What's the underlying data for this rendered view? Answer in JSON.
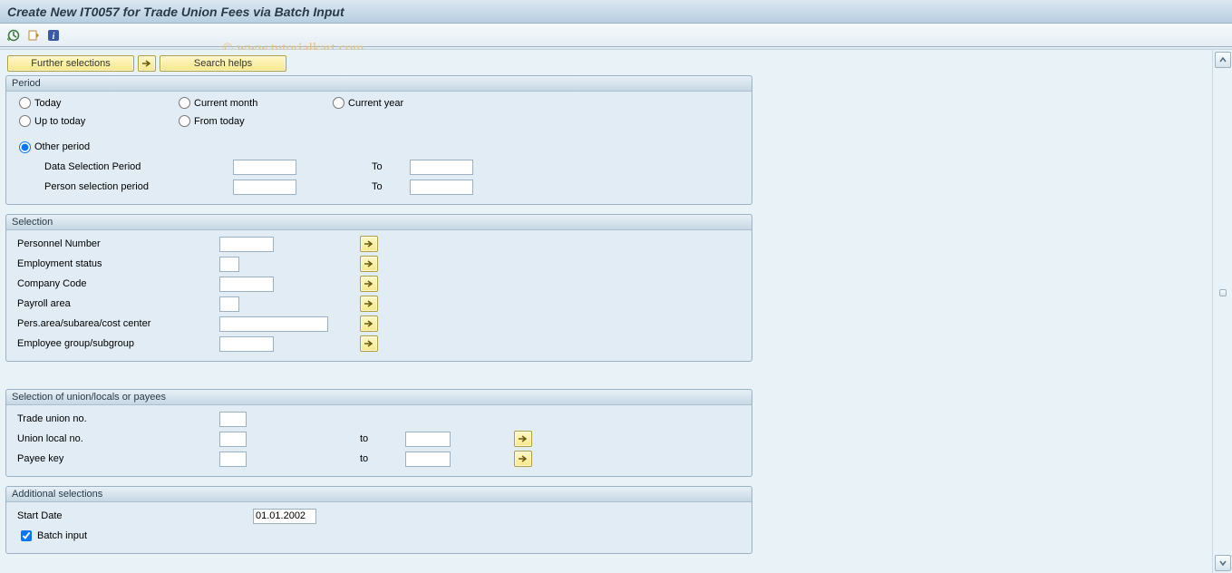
{
  "header": {
    "title": "Create New IT0057 for Trade Union Fees via Batch Input"
  },
  "watermark": "© www.tutorialkart.com",
  "toolbar": {
    "execute_icon": "execute-icon",
    "variant_icon": "variant-icon",
    "info_icon": "info-icon"
  },
  "btnrow": {
    "further_selections": "Further selections",
    "search_helps": "Search helps"
  },
  "period": {
    "title": "Period",
    "radios": {
      "today": "Today",
      "current_month": "Current month",
      "current_year": "Current year",
      "up_to_today": "Up to today",
      "from_today": "From today",
      "other_period": "Other period"
    },
    "data_sel_label": "Data Selection Period",
    "person_sel_label": "Person selection period",
    "to": "To",
    "data_from": "",
    "data_to": "",
    "person_from": "",
    "person_to": ""
  },
  "selection": {
    "title": "Selection",
    "rows": [
      {
        "label": "Personnel Number",
        "value": "",
        "size": "sm"
      },
      {
        "label": "Employment status",
        "value": "",
        "size": "xs"
      },
      {
        "label": "Company Code",
        "value": "",
        "size": "sm"
      },
      {
        "label": "Payroll area",
        "value": "",
        "size": "xs"
      },
      {
        "label": "Pers.area/subarea/cost center",
        "value": "",
        "size": "mdl"
      },
      {
        "label": "Employee group/subgroup",
        "value": "",
        "size": "sm"
      }
    ]
  },
  "union": {
    "title": "Selection of union/locals or payees",
    "to": "to",
    "rows": [
      {
        "label": "Trade union no.",
        "v1": "",
        "to": false
      },
      {
        "label": "Union local no.",
        "v1": "",
        "v2": "",
        "to": true
      },
      {
        "label": "Payee key",
        "v1": "",
        "v2": "",
        "to": true
      }
    ]
  },
  "additional": {
    "title": "Additional selections",
    "start_date_label": "Start Date",
    "start_date": "01.01.2002",
    "batch_input_label": "Batch input",
    "batch_input_checked": true
  }
}
